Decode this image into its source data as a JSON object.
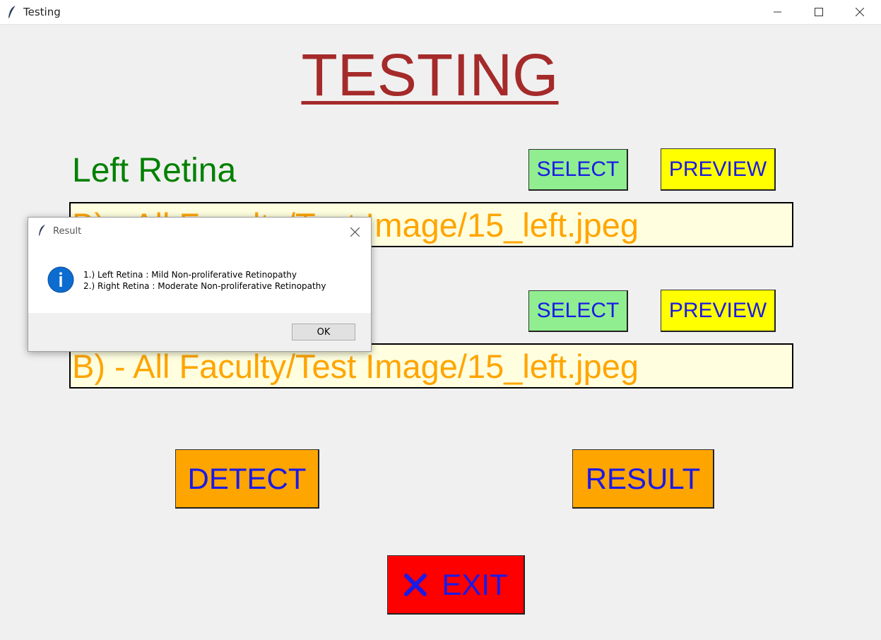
{
  "window": {
    "title": "Testing",
    "minimize_icon": "minimize-icon",
    "maximize_icon": "maximize-icon",
    "close_icon": "close-icon"
  },
  "main": {
    "heading": "TESTING",
    "left": {
      "label": "Left Retina",
      "select_label": "SELECT",
      "preview_label": "PREVIEW",
      "path_value": "B) - All Faculty/Test Image/15_left.jpeg"
    },
    "right": {
      "select_label": "SELECT",
      "preview_label": "PREVIEW",
      "path_value": "B) - All Faculty/Test Image/15_left.jpeg"
    },
    "detect_label": "DETECT",
    "result_label": "RESULT",
    "exit_label": "EXIT",
    "exit_icon": "x-icon"
  },
  "dialog": {
    "title": "Result",
    "line1": "1.) Left Retina : Mild Non-proliferative Retinopathy",
    "line2": "2.) Right Retina : Moderate Non-proliferative Retinopathy",
    "ok_label": "OK",
    "icon": "info-icon"
  },
  "colors": {
    "heading": "#a52a2a",
    "label": "#008000",
    "button_text": "#1a1ae6",
    "select_bg": "#90ee90",
    "preview_bg": "#ffff00",
    "action_bg": "#ffa500",
    "exit_bg": "#ff0000",
    "path_bg": "#ffffe0",
    "path_text": "#ffa500"
  }
}
